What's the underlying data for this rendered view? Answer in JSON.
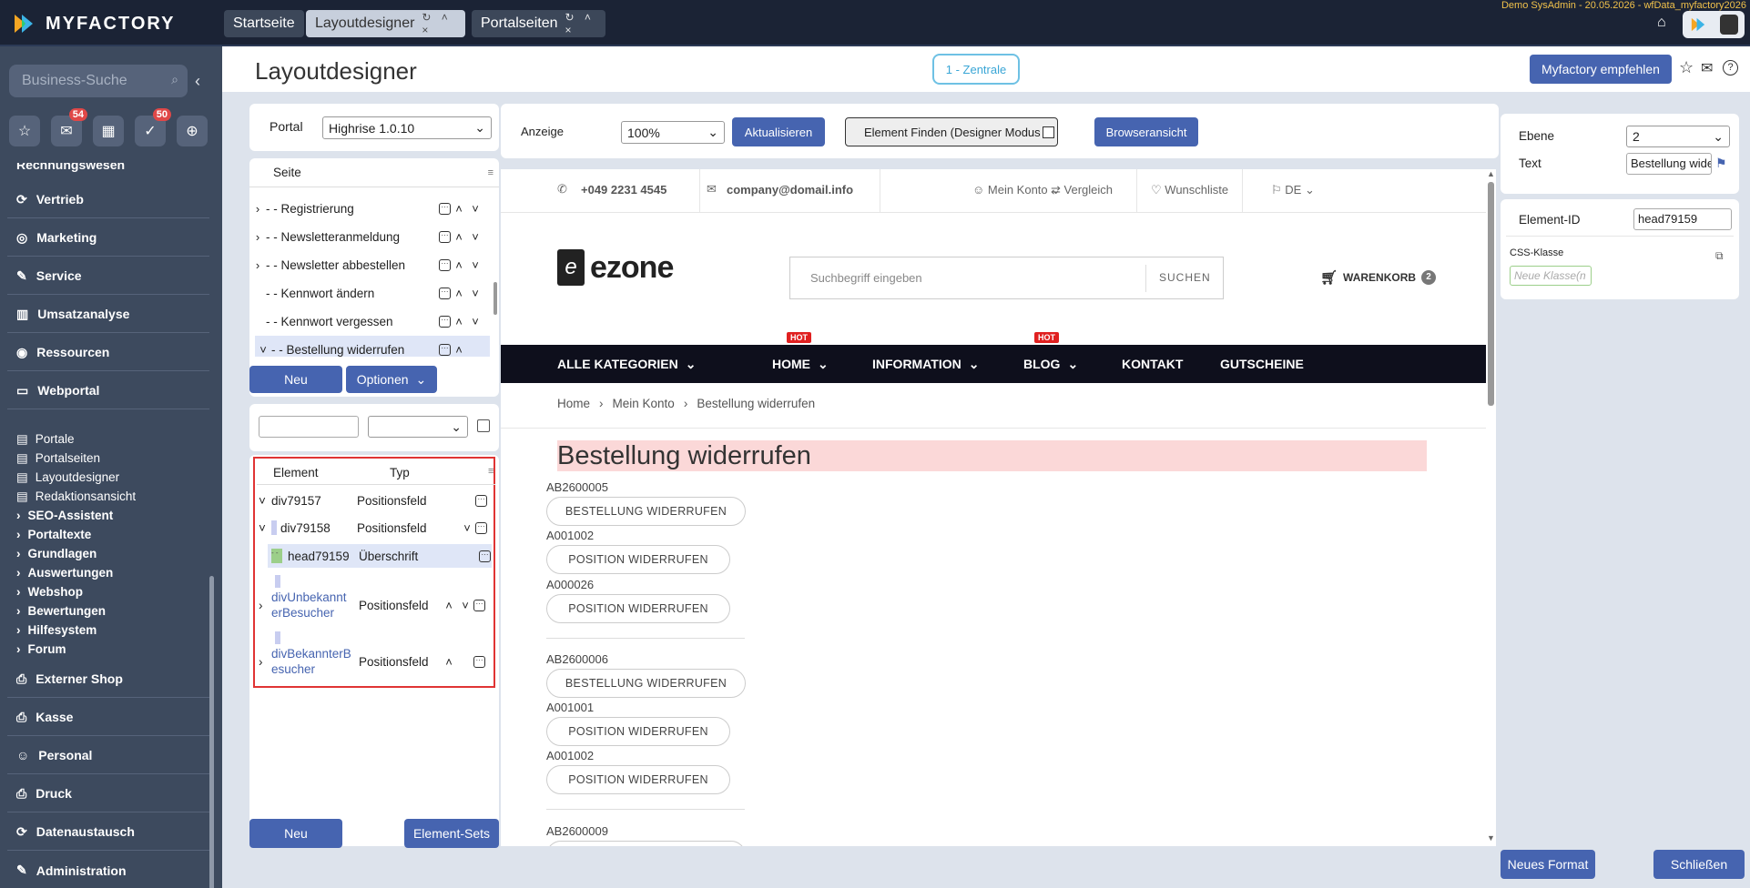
{
  "topbar": {
    "logo_text": "MYFACTORY",
    "tabs": [
      {
        "label": "Startseite",
        "active": false,
        "controls": ""
      },
      {
        "label": "Layoutdesigner",
        "active": true,
        "controls": "↻ ˄ ×"
      },
      {
        "label": "Portalseiten",
        "active": false,
        "controls": "↻ ˄ ×"
      }
    ],
    "user_info": "Demo SysAdmin - 20.05.2026 - wfData_myfactory2026"
  },
  "sidebar": {
    "search_placeholder": "Business-Suche",
    "quick": [
      {
        "icon": "star-icon",
        "badge": ""
      },
      {
        "icon": "mail-icon",
        "badge": "54"
      },
      {
        "icon": "calendar-icon",
        "badge": ""
      },
      {
        "icon": "check-icon",
        "badge": "50"
      },
      {
        "icon": "plus-icon",
        "badge": ""
      }
    ],
    "cut_item": "Rechnungswesen",
    "nav_top": [
      "Vertrieb",
      "Marketing",
      "Service",
      "Umsatzanalyse",
      "Ressourcen",
      "Webportal"
    ],
    "webportal_items": [
      "Portale",
      "Portalseiten",
      "Layoutdesigner",
      "Redaktionsansicht"
    ],
    "webportal_groups": [
      "SEO-Assistent",
      "Portaltexte",
      "Grundlagen",
      "Auswertungen",
      "Webshop",
      "Bewertungen",
      "Hilfesystem",
      "Forum"
    ],
    "nav_bottom": [
      "Externer Shop",
      "Kasse",
      "Personal",
      "Druck",
      "Datenaustausch",
      "Administration"
    ]
  },
  "header": {
    "title": "Layoutdesigner",
    "zentrale": "1 - Zentrale",
    "recommend": "Myfactory empfehlen"
  },
  "portal": {
    "label": "Portal",
    "value": "Highrise 1.0.10"
  },
  "toolbar": {
    "anzeige_label": "Anzeige",
    "zoom": "100%",
    "refresh": "Aktualisieren",
    "finder": "Element Finden (Designer Modus",
    "browser": "Browseransicht"
  },
  "pages_tree": {
    "header": "Seite",
    "rows": [
      {
        "label": "- - Registrierung",
        "exp": "›"
      },
      {
        "label": "- - Newsletteranmeldung",
        "exp": "›"
      },
      {
        "label": "- - Newsletter abbestellen",
        "exp": "›"
      },
      {
        "label": "- - Kennwort ändern",
        "exp": ""
      },
      {
        "label": "- - Kennwort vergessen",
        "exp": ""
      },
      {
        "label": "- - Bestellung widerrufen",
        "exp": "˅"
      }
    ],
    "new_btn": "Neu",
    "options_btn": "Optionen"
  },
  "elements": {
    "col_element": "Element",
    "col_type": "Typ",
    "rows": [
      {
        "name": "div79157",
        "type": "Positionsfeld"
      },
      {
        "name": "div79158",
        "type": "Positionsfeld"
      },
      {
        "name": "head79159",
        "type": "Überschrift"
      },
      {
        "name": "divUnbekannterBesucher",
        "type": "Positionsfeld"
      },
      {
        "name": "divBekannterBesucher",
        "type": "Positionsfeld"
      }
    ],
    "new_btn": "Neu",
    "sets_btn": "Element-Sets"
  },
  "preview": {
    "phone": "+049 2231 4545",
    "email": "company@domail.info",
    "account": "Mein Konto",
    "compare": "Vergleich",
    "wishlist": "Wunschliste",
    "lang": "DE",
    "brand": "ezone",
    "search_placeholder": "Suchbegriff eingeben",
    "search_btn": "SUCHEN",
    "cart": "WARENKORB",
    "cart_count": "2",
    "nav": [
      "ALLE KATEGORIEN",
      "HOME",
      "INFORMATION",
      "BLOG",
      "KONTAKT",
      "GUTSCHEINE"
    ],
    "hot": "HOT",
    "breadcrumb": [
      "Home",
      "Mein Konto",
      "Bestellung widerrufen"
    ],
    "heading": "Bestellung widerrufen",
    "blocks": [
      {
        "order": "AB2600005",
        "btn": "BESTELLUNG WIDERRUFEN",
        "positions": [
          {
            "code": "A001002",
            "btn": "POSITION WIDERRUFEN"
          },
          {
            "code": "A000026",
            "btn": "POSITION WIDERRUFEN"
          }
        ]
      },
      {
        "order": "AB2600006",
        "btn": "BESTELLUNG WIDERRUFEN",
        "positions": [
          {
            "code": "A001001",
            "btn": "POSITION WIDERRUFEN"
          },
          {
            "code": "A001002",
            "btn": "POSITION WIDERRUFEN"
          }
        ]
      },
      {
        "order": "AB2600009",
        "btn": "",
        "positions": []
      }
    ]
  },
  "rightpanel": {
    "ebene_label": "Ebene",
    "ebene_value": "2",
    "text_label": "Text",
    "text_value": "Bestellung wide",
    "element_id_label": "Element-ID",
    "element_id_value": "head79159",
    "css_label": "CSS-Klasse",
    "css_placeholder": "Neue Klasse(n"
  },
  "footer": {
    "new_format": "Neues Format",
    "close": "Schließen"
  }
}
